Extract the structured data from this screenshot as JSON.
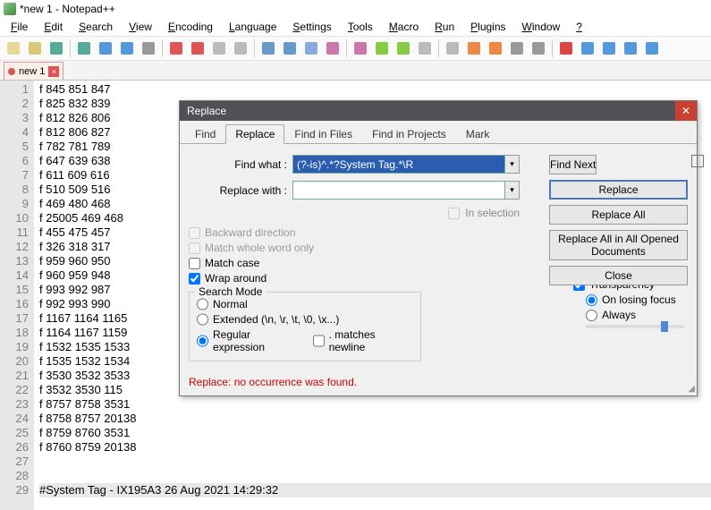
{
  "window": {
    "title": "*new 1 - Notepad++"
  },
  "menu": [
    "File",
    "Edit",
    "Search",
    "View",
    "Encoding",
    "Language",
    "Settings",
    "Tools",
    "Macro",
    "Run",
    "Plugins",
    "Window",
    "?"
  ],
  "doc_tab": {
    "label": "new 1"
  },
  "lines": [
    "f 845 851 847",
    "f 825 832 839",
    "f 812 826 806",
    "f 812 806 827",
    "f 782 781 789",
    "f 647 639 638",
    "f 611 609 616",
    "f 510 509 516",
    "f 469 480 468",
    "f 25005 469 468",
    "f 455 475 457",
    "f 326 318 317",
    "f 959 960 950",
    "f 960 959 948",
    "f 993 992 987",
    "f 992 993 990",
    "f 1167 1164 1165",
    "f 1164 1167 1159",
    "f 1532 1535 1533",
    "f 1535 1532 1534",
    "f 3530 3532 3533",
    "f 3532 3530 115",
    "f 8757 8758 3531",
    "f 8758 8757 20138",
    "f 8759 8760 3531",
    "f 8760 8759 20138",
    "",
    "",
    "#System Tag - IX195A3 26 Aug 2021 14:29:32"
  ],
  "dialog": {
    "title": "Replace",
    "tabs": [
      "Find",
      "Replace",
      "Find in Files",
      "Find in Projects",
      "Mark"
    ],
    "active_tab": 1,
    "find_label": "Find what :",
    "find_value": "(?-is)^.*?System Tag.*\\R",
    "replace_label": "Replace with :",
    "replace_value": "",
    "in_selection": "In selection",
    "opts": {
      "backward": "Backward direction",
      "whole": "Match whole word only",
      "case": "Match case",
      "wrap": "Wrap around"
    },
    "search_mode": {
      "legend": "Search Mode",
      "normal": "Normal",
      "extended": "Extended (\\n, \\r, \\t, \\0, \\x...)",
      "regex": "Regular expression",
      "dotnl": ". matches newline"
    },
    "transparency": {
      "legend": "Transparency",
      "losing": "On losing focus",
      "always": "Always"
    },
    "buttons": {
      "find_next": "Find Next",
      "replace": "Replace",
      "replace_all": "Replace All",
      "replace_all_open": "Replace All in All Opened Documents",
      "close": "Close"
    },
    "status": "Replace: no occurrence was found."
  },
  "colors": {
    "find_highlight": "#2a5db0"
  }
}
